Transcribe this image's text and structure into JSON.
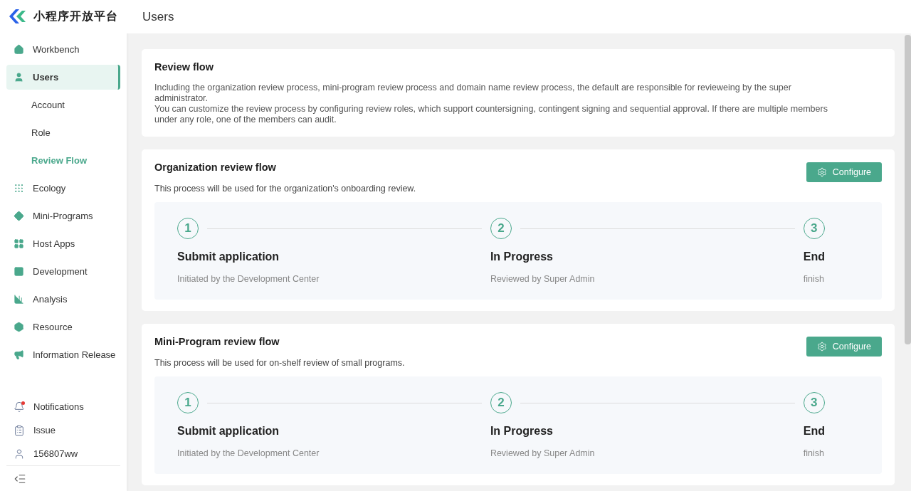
{
  "logo": {
    "title": "小程序开放平台"
  },
  "sidebar": {
    "items": [
      {
        "label": "Workbench",
        "selected": false
      },
      {
        "label": "Users",
        "selected": true,
        "children": [
          {
            "label": "Account",
            "selected": false
          },
          {
            "label": "Role",
            "selected": false
          },
          {
            "label": "Review Flow",
            "selected": true
          }
        ]
      },
      {
        "label": "Ecology",
        "selected": false
      },
      {
        "label": "Mini-Programs",
        "selected": false
      },
      {
        "label": "Host Apps",
        "selected": false
      },
      {
        "label": "Development",
        "selected": false
      },
      {
        "label": "Analysis",
        "selected": false
      },
      {
        "label": "Resource",
        "selected": false
      },
      {
        "label": "Information Release",
        "selected": false
      }
    ],
    "bottom_items": [
      {
        "label": "Notifications",
        "unread": true
      },
      {
        "label": "Issue",
        "unread": false
      },
      {
        "label": "156807ww",
        "unread": false
      }
    ]
  },
  "header": {
    "title": "Users"
  },
  "intro": {
    "title": "Review flow",
    "paragraphs": [
      "Including the organization review process, mini-program review process and domain name review process, the default are responsible for revieweing by the super administrator.",
      "You can customize the review process by configuring review roles, which support countersigning, contingent signing and sequential approval. If there are multiple members under any role, one of the members can audit."
    ]
  },
  "flows": [
    {
      "title": "Organization review flow",
      "description": "This process will be used for the organization's onboarding review.",
      "button": "Configure",
      "steps": [
        {
          "number": "1",
          "title": "Submit application",
          "subtitle": "Initiated by the Development Center"
        },
        {
          "number": "2",
          "title": "In Progress",
          "subtitle": "Reviewed by Super Admin"
        },
        {
          "number": "3",
          "title": "End",
          "subtitle": "finish"
        }
      ]
    },
    {
      "title": "Mini-Program review flow",
      "description": "This process will be used for on-shelf review of small programs.",
      "button": "Configure",
      "steps": [
        {
          "number": "1",
          "title": "Submit application",
          "subtitle": "Initiated by the Development Center"
        },
        {
          "number": "2",
          "title": "In Progress",
          "subtitle": "Reviewed by Super Admin"
        },
        {
          "number": "3",
          "title": "End",
          "subtitle": "finish"
        }
      ]
    }
  ]
}
